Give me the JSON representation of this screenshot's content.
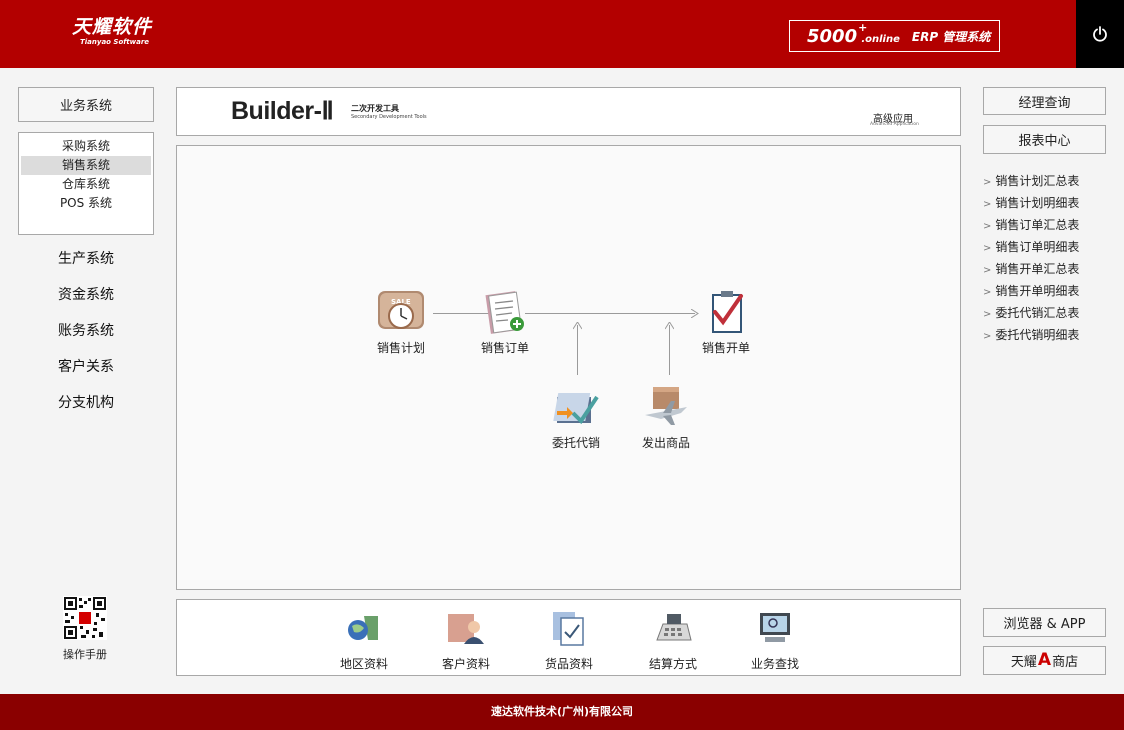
{
  "header": {
    "logo_cn": "天耀软件",
    "logo_en": "Tianyao Software",
    "sys_num": "5000",
    "sys_plus": "+",
    "sys_online": ".online",
    "sys_name": "ERP 管理系统",
    "power_icon": "power-icon"
  },
  "left": {
    "top_button": "业务系统",
    "sub_items": [
      "采购系统",
      "销售系统",
      "仓库系统",
      "POS 系统"
    ],
    "active_sub": "销售系统",
    "nav_items": [
      "生产系统",
      "资金系统",
      "账务系统",
      "客户关系",
      "分支机构"
    ],
    "manual_label": "操作手册"
  },
  "banner": {
    "title": "Builder-Ⅱ",
    "sub_cn": "二次开发工具",
    "sub_en": "Secondary Development Tools",
    "right_cn": "高级应用",
    "right_en": "Advanced Application"
  },
  "flow": {
    "nodes": {
      "plan": "销售计划",
      "order": "销售订单",
      "invoice": "销售开单",
      "consign": "委托代销",
      "ship": "发出商品"
    },
    "plan_badge": "SALE"
  },
  "bottom": {
    "items": [
      "地区资料",
      "客户资料",
      "货品资料",
      "结算方式",
      "业务查找"
    ]
  },
  "right": {
    "btn_query": "经理查询",
    "btn_report": "报表中心",
    "links": [
      "销售计划汇总表",
      "销售计划明细表",
      "销售订单汇总表",
      "销售订单明细表",
      "销售开单汇总表",
      "销售开单明细表",
      "委托代销汇总表",
      "委托代销明细表"
    ],
    "btn_browser": "浏览器 & APP",
    "shop_prefix": "天耀",
    "shop_mark": "A",
    "shop_suffix": "商店"
  },
  "footer": {
    "company": "速达软件技术(广州)有限公司"
  },
  "colors": {
    "header": "#b30000",
    "footer": "#8a0000",
    "shop_mark": "#cc0000"
  }
}
